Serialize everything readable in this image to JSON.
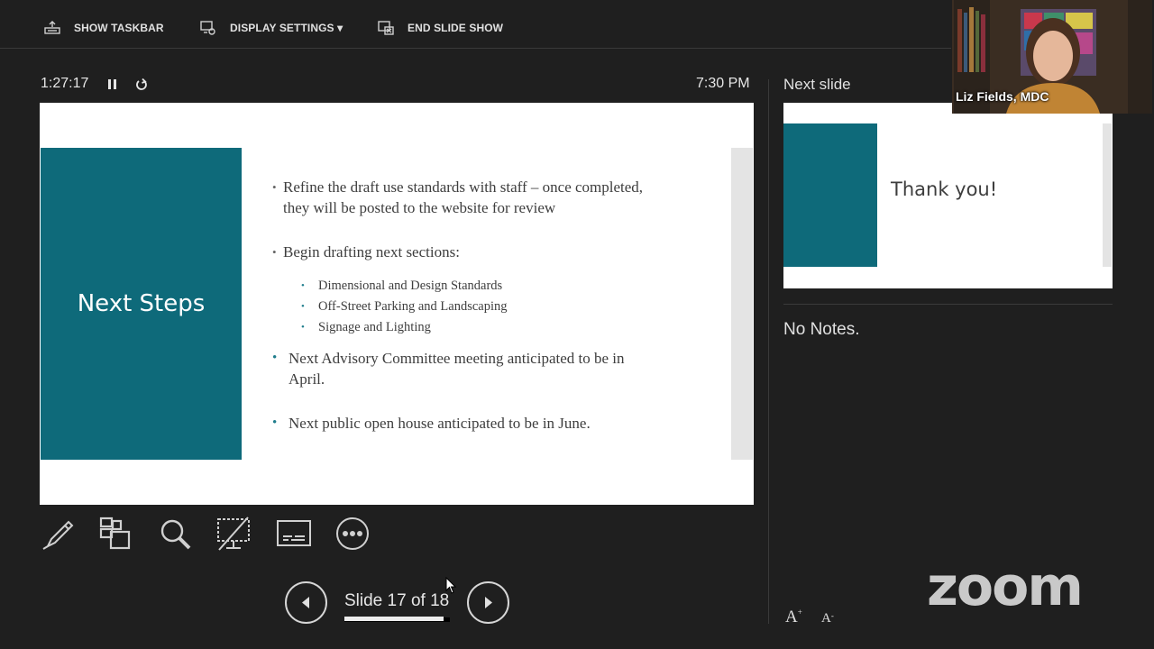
{
  "toolbar": {
    "show_taskbar": "SHOW TASKBAR",
    "display_settings": "DISPLAY SETTINGS ▾",
    "end_slide_show": "END SLIDE SHOW"
  },
  "timer": {
    "elapsed": "1:27:17",
    "clock": "7:30 PM"
  },
  "current_slide": {
    "title": "Next Steps",
    "bullets": [
      "Refine the draft use standards with staff – once completed,",
      "they will be posted to the website for review",
      "Begin drafting next sections:",
      "Next Advisory Committee meeting anticipated to be in",
      "April.",
      "Next public open house anticipated to be in June."
    ],
    "sub_bullets": [
      "Dimensional and Design Standards",
      "Off-Street Parking and Landscaping",
      "Signage and Lighting"
    ],
    "dot": "•"
  },
  "navigation": {
    "slide_label": "Slide 17 of 18",
    "progress": 0.944
  },
  "next_slide": {
    "label": "Next slide",
    "title": "Thank you!"
  },
  "notes": {
    "text": "No Notes."
  },
  "font_controls": {
    "increase": "A",
    "decrease": "A"
  },
  "webcam": {
    "name": "Liz Fields, MDC"
  },
  "brand": {
    "logo": "zoom"
  },
  "colors": {
    "slide_accent": "#0e6a7a",
    "background": "#1f1f1f"
  },
  "icons": [
    "taskbar-icon",
    "display-settings-icon",
    "end-show-icon",
    "pause-icon",
    "reset-icon",
    "pen-icon",
    "slides-grid-icon",
    "magnifier-icon",
    "pointer-screen-icon",
    "subtitles-icon",
    "more-icon",
    "prev-icon",
    "next-icon",
    "cursor-icon"
  ]
}
